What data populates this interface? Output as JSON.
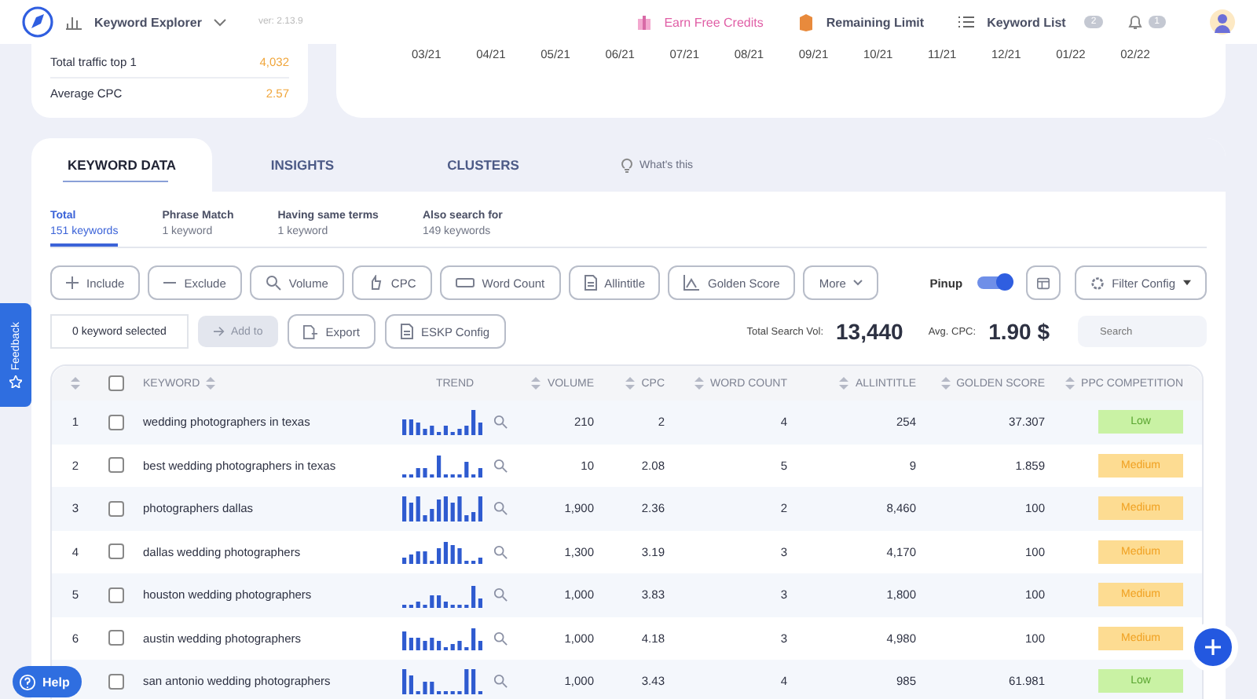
{
  "header": {
    "app_name": "Keyword Explorer",
    "version": "ver: 2.13.9",
    "earn_credits": "Earn Free Credits",
    "remaining_limit": "Remaining Limit",
    "keyword_list": "Keyword List",
    "keyword_list_count": "2",
    "notifications_count": "1"
  },
  "summary": [
    {
      "label": "Total traffic top 1",
      "value": "4,032"
    },
    {
      "label": "Average CPC",
      "value": "2.57"
    }
  ],
  "chart_months": [
    "03/21",
    "04/21",
    "05/21",
    "06/21",
    "07/21",
    "08/21",
    "09/21",
    "10/21",
    "11/21",
    "12/21",
    "01/22",
    "02/22"
  ],
  "tabs": [
    {
      "label": "KEYWORD DATA",
      "selected": true
    },
    {
      "label": "INSIGHTS",
      "selected": false
    },
    {
      "label": "CLUSTERS",
      "selected": false
    }
  ],
  "help_link": "What's this",
  "subtabs": [
    {
      "label": "Total",
      "count": "151 keywords",
      "selected": true
    },
    {
      "label": "Phrase Match",
      "count": "1 keyword",
      "selected": false
    },
    {
      "label": "Having same terms",
      "count": "1 keyword",
      "selected": false
    },
    {
      "label": "Also search for",
      "count": "149 keywords",
      "selected": false
    }
  ],
  "filters": [
    {
      "label": "Include",
      "kind": "include"
    },
    {
      "label": "Exclude",
      "kind": "exclude"
    },
    {
      "label": "Volume",
      "kind": "volume"
    },
    {
      "label": "CPC",
      "kind": "cpc"
    },
    {
      "label": "Word Count",
      "kind": "count"
    },
    {
      "label": "Allintitle",
      "kind": "doc"
    },
    {
      "label": "Golden Score",
      "kind": "score"
    },
    {
      "label": "More",
      "kind": "more"
    }
  ],
  "pinup": {
    "label": "Pinup",
    "on": true
  },
  "filter_config": "Filter Config",
  "selection": "0 keyword selected",
  "add_to": {
    "label": "Add to",
    "disabled": true
  },
  "export": "Export",
  "eskp_config": "ESKP Config",
  "totals": {
    "volume_label": "Total Search Vol:",
    "volume": "13,440",
    "cpc_label": "Avg. CPC:",
    "cpc": "1.90 $"
  },
  "search": {
    "placeholder": "Search"
  },
  "table": {
    "all_checked": false,
    "columns": [
      "KEYWORD",
      "TREND",
      "VOLUME",
      "CPC",
      "WORD COUNT",
      "ALLINTITLE",
      "GOLDEN SCORE",
      "PPC COMPETITION"
    ],
    "rows": [
      {
        "index": "1",
        "checked": false,
        "keyword": "wedding photographers in texas",
        "volume": "210",
        "cpc": "2",
        "word_count": "4",
        "allintitle": "254",
        "golden_score": "37.307",
        "competition": "Low",
        "kind": "low"
      },
      {
        "index": "2",
        "checked": false,
        "keyword": "best wedding photographers in texas",
        "volume": "10",
        "cpc": "2.08",
        "word_count": "5",
        "allintitle": "9",
        "golden_score": "1.859",
        "competition": "Medium",
        "kind": "medium"
      },
      {
        "index": "3",
        "checked": false,
        "keyword": "photographers dallas",
        "volume": "1,900",
        "cpc": "2.36",
        "word_count": "2",
        "allintitle": "8,460",
        "golden_score": "100",
        "competition": "Medium",
        "kind": "medium"
      },
      {
        "index": "4",
        "checked": false,
        "keyword": "dallas wedding photographers",
        "volume": "1,300",
        "cpc": "3.19",
        "word_count": "3",
        "allintitle": "4,170",
        "golden_score": "100",
        "competition": "Medium",
        "kind": "medium"
      },
      {
        "index": "5",
        "checked": false,
        "keyword": "houston wedding photographers",
        "volume": "1,000",
        "cpc": "3.83",
        "word_count": "3",
        "allintitle": "1,800",
        "golden_score": "100",
        "competition": "Medium",
        "kind": "medium"
      },
      {
        "index": "6",
        "checked": false,
        "keyword": "austin wedding photographers",
        "volume": "1,000",
        "cpc": "4.18",
        "word_count": "3",
        "allintitle": "4,980",
        "golden_score": "100",
        "competition": "Medium",
        "kind": "medium"
      },
      {
        "index": "",
        "checked": false,
        "keyword": "san antonio wedding photographers",
        "volume": "1,000",
        "cpc": "3.43",
        "word_count": "4",
        "allintitle": "985",
        "golden_score": "61.981",
        "competition": "Low",
        "kind": "low"
      }
    ]
  },
  "feedback": "Feedback",
  "help": "Help"
}
